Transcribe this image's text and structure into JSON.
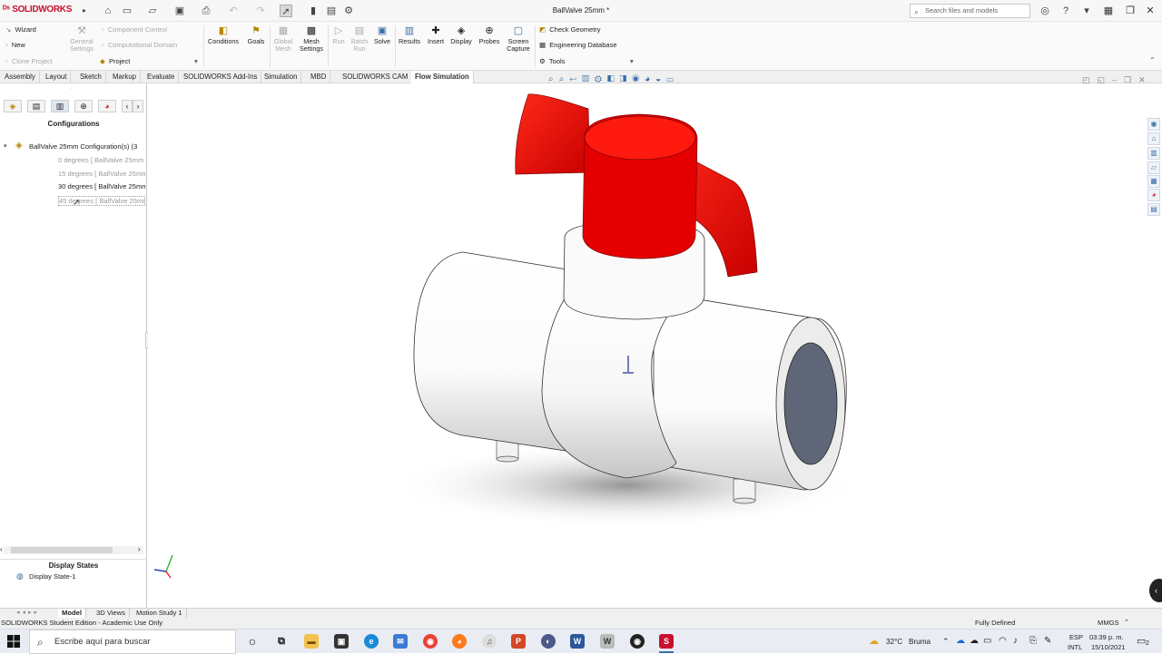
{
  "app": {
    "logo": "SOLIDWORKS",
    "document_title": "BallValve 25mm *",
    "search_placeholder": "Search files and models"
  },
  "command_manager": {
    "left_items": [
      {
        "label": "Wizard",
        "disabled": false
      },
      {
        "label": "New",
        "disabled": false
      },
      {
        "label": "Clone Project",
        "disabled": true
      }
    ],
    "general_settings": "General\nSettings",
    "mid_items": [
      {
        "label": "Component Control",
        "disabled": true
      },
      {
        "label": "Computational Domain",
        "disabled": true
      },
      {
        "label": "Project",
        "disabled": false
      }
    ],
    "buttons": [
      {
        "label": "Conditions",
        "disabled": false
      },
      {
        "label": "Goals",
        "disabled": false
      },
      {
        "label": "Global\nMesh",
        "disabled": true
      },
      {
        "label": "Mesh\nSettings",
        "disabled": false
      },
      {
        "label": "Run",
        "disabled": true
      },
      {
        "label": "Batch\nRun",
        "disabled": true
      },
      {
        "label": "Solve",
        "disabled": false
      },
      {
        "label": "Results",
        "disabled": false
      },
      {
        "label": "Insert",
        "disabled": false
      },
      {
        "label": "Display",
        "disabled": false
      },
      {
        "label": "Probes",
        "disabled": false
      },
      {
        "label": "Screen\nCapture",
        "disabled": false
      }
    ],
    "right_items": [
      "Check Geometry",
      "Engineering Database",
      "Tools"
    ]
  },
  "tabs": [
    {
      "label": "Assembly",
      "active": false
    },
    {
      "label": "Layout",
      "active": false
    },
    {
      "label": "Sketch",
      "active": false
    },
    {
      "label": "Markup",
      "active": false
    },
    {
      "label": "Evaluate",
      "active": false
    },
    {
      "label": "SOLIDWORKS Add-Ins",
      "active": false
    },
    {
      "label": "Simulation",
      "active": false
    },
    {
      "label": "MBD",
      "active": false
    },
    {
      "label": "SOLIDWORKS CAM",
      "active": false
    },
    {
      "label": "Flow Simulation",
      "active": true
    }
  ],
  "config_manager": {
    "header": "Configurations",
    "root": "BallValve 25mm Configuration(s)  (3",
    "items": [
      {
        "label": "0 degrees [ BallValve 25mm",
        "active": false
      },
      {
        "label": "15 degrees [ BallValve 25mm",
        "active": false
      },
      {
        "label": "30 degrees [ BallValve 25mm",
        "active": true
      },
      {
        "label": "45 degrees [ BallValve 25mm",
        "active": false
      }
    ],
    "display_states_header": "Display States",
    "display_state": "Display State-1"
  },
  "bottom_tabs": [
    {
      "label": "Model",
      "active": true
    },
    {
      "label": "3D Views",
      "active": false
    },
    {
      "label": "Motion Study 1",
      "active": false
    }
  ],
  "status": {
    "edition": "SOLIDWORKS Student Edition - Academic Use Only",
    "state": "Fully Defined",
    "units": "MMGS"
  },
  "taskbar": {
    "search_placeholder": "Escribe aquí para buscar",
    "weather_temp": "32°C",
    "weather_text": "Bruma",
    "lang_top": "ESP",
    "lang_bottom": "INTL",
    "time": "03:39 p. m.",
    "date": "15/10/2021",
    "notification_count": "2"
  },
  "colors": {
    "handle": "#e00000",
    "body": "#ffffff",
    "bore": "#5f6677",
    "brand": "#c8102e",
    "accent": "#3a6ea5"
  }
}
